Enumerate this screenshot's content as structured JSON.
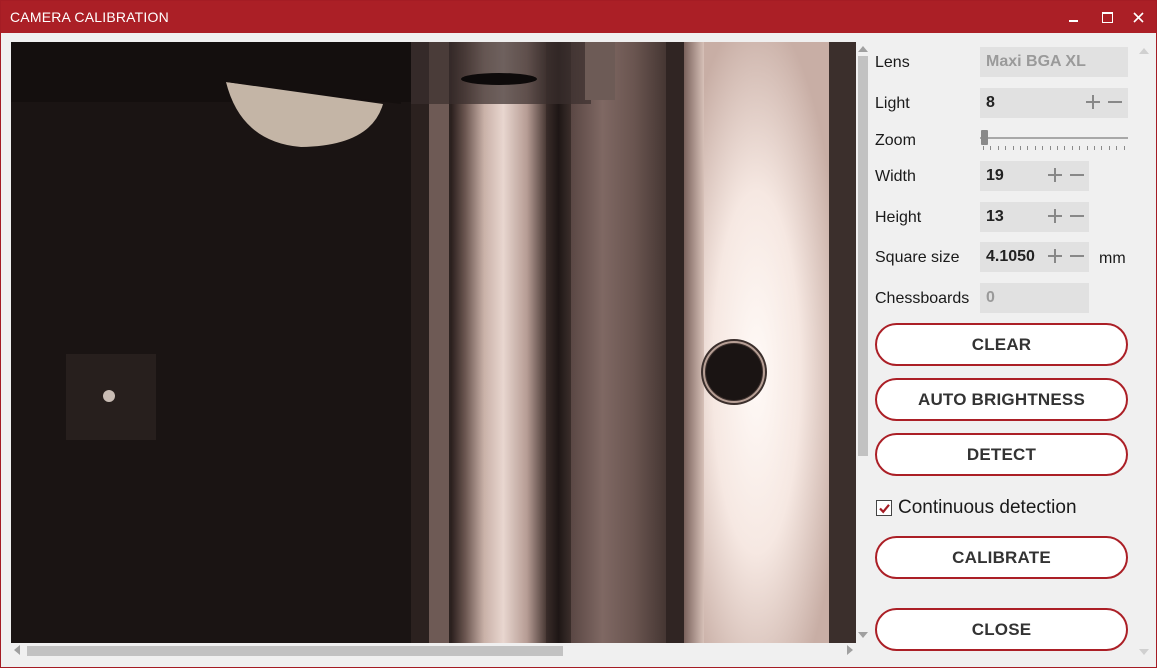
{
  "window": {
    "title": "CAMERA CALIBRATION",
    "accent_color": "#ab1f26",
    "controls": [
      "minimize-icon",
      "maximize-icon",
      "close-icon"
    ]
  },
  "camera_view": {
    "content": "live camera image of metal rails with a round hole"
  },
  "settings": {
    "lens": {
      "label": "Lens",
      "value": "Maxi BGA XL"
    },
    "light": {
      "label": "Light",
      "value": "8"
    },
    "zoom": {
      "label": "Zoom",
      "level": 0
    },
    "width": {
      "label": "Width",
      "value": "19"
    },
    "height": {
      "label": "Height",
      "value": "13"
    },
    "square_size": {
      "label": "Square size",
      "value": "4.1050",
      "unit": "mm"
    },
    "chessboards": {
      "label": "Chessboards",
      "value": "0"
    }
  },
  "buttons": {
    "clear": "CLEAR",
    "auto_brightness": "AUTO BRIGHTNESS",
    "detect": "DETECT",
    "calibrate": "CALIBRATE",
    "close": "CLOSE"
  },
  "continuous_detection": {
    "label": "Continuous detection",
    "checked": true
  }
}
